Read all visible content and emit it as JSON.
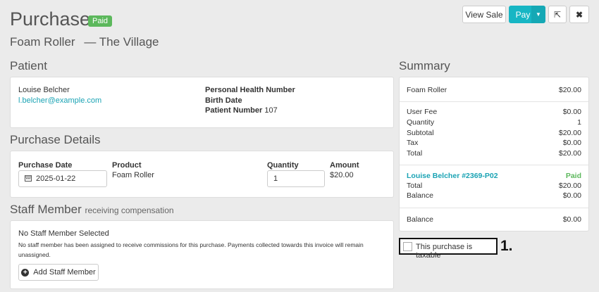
{
  "header": {
    "title": "Purchase",
    "status_badge": "Paid",
    "product": "Foam Roller",
    "location": "— The Village",
    "view_sale_label": "View Sale",
    "pay_label": "Pay",
    "pay_caret": "▼",
    "share_icon": "⇱",
    "close_icon": "✖"
  },
  "patient": {
    "section_title": "Patient",
    "name": "Louise Belcher",
    "email": "l.belcher@example.com",
    "phn_label": "Personal Health Number",
    "birth_label": "Birth Date",
    "patient_number_label": "Patient Number",
    "patient_number": "107"
  },
  "purchase_details": {
    "section_title": "Purchase Details",
    "date_label": "Purchase Date",
    "date_value": "2025-01-22",
    "product_label": "Product",
    "product_value": "Foam Roller",
    "quantity_label": "Quantity",
    "quantity_value": "1",
    "amount_label": "Amount",
    "amount_value": "$20.00"
  },
  "staff": {
    "section_title": "Staff Member",
    "section_subtitle": "receiving compensation",
    "none_selected": "No Staff Member Selected",
    "description": "No staff member has been assigned to receive commissions for this purchase. Payments collected towards this invoice will remain unassigned.",
    "add_button": "Add Staff Member"
  },
  "summary": {
    "section_title": "Summary",
    "item_name": "Foam Roller",
    "item_amount": "$20.00",
    "user_fee_label": "User Fee",
    "user_fee": "$0.00",
    "quantity_label": "Quantity",
    "quantity": "1",
    "subtotal_label": "Subtotal",
    "subtotal": "$20.00",
    "tax_label": "Tax",
    "tax": "$0.00",
    "total_label": "Total",
    "total": "$20.00",
    "invoice_name": "Louise Belcher #2369-P02",
    "invoice_status": "Paid",
    "invoice_total_label": "Total",
    "invoice_total": "$20.00",
    "invoice_balance_label": "Balance",
    "invoice_balance": "$0.00",
    "balance_label": "Balance",
    "balance": "$0.00"
  },
  "taxable": {
    "label": "This purchase is taxable",
    "checked": false,
    "step_marker": "1."
  },
  "colors": {
    "accent": "#17b6c4",
    "paid_green": "#5cb85c",
    "link": "#1aa3b4"
  }
}
